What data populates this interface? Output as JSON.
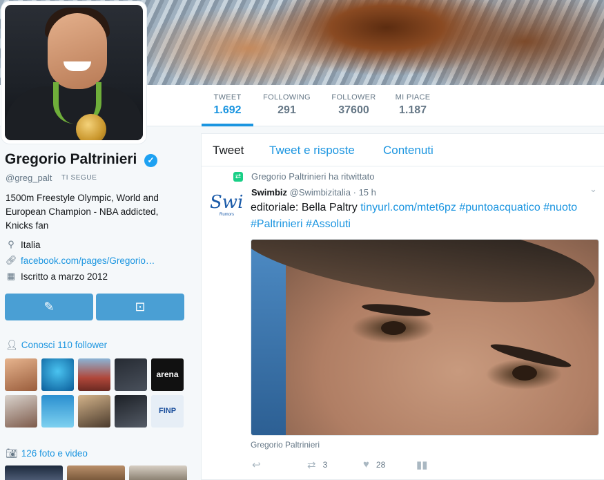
{
  "profile": {
    "name": "Gregorio Paltrinieri",
    "verified_icon": "verified-badge-icon",
    "handle": "@greg_palt",
    "follows_you": "TI SEGUE",
    "bio": "1500m Freestyle Olympic, World and European Champion - NBA addicted, Knicks fan",
    "location": "Italia",
    "website": "facebook.com/pages/Gregorio…",
    "joined": "Iscritto a marzo 2012"
  },
  "stats": [
    {
      "label": "TWEET",
      "value": "1.692"
    },
    {
      "label": "FOLLOWING",
      "value": "291"
    },
    {
      "label": "FOLLOWER",
      "value": "37600"
    },
    {
      "label": "MI PIACE",
      "value": "1.187"
    }
  ],
  "sidebar": {
    "followers_you_know": "Conosci 110 follower",
    "photos_videos": "126 foto e video",
    "follower_thumb_texts": {
      "arena": "arena",
      "finp": "FINP"
    }
  },
  "timeline": {
    "tabs": [
      "Tweet",
      "Tweet e risposte",
      "Contenuti"
    ],
    "retweet_note": "Gregorio Paltrinieri ha ritwittato",
    "tweet": {
      "author_name": "Swimbiz",
      "author_handle": "@Swimbizitalia",
      "time": "15 h",
      "text_plain": "editoriale: Bella Paltry ",
      "link": "tinyurl.com/mtet6pz",
      "hashtag1": "#puntoacquatico",
      "hashtag2": "#nuoto",
      "hashtag3": "#Paltrinieri",
      "hashtag4": "#Assoluti",
      "photo_caption": "Gregorio Paltrinieri",
      "avatar_text": "Swi",
      "avatar_subtext": "Rumors",
      "retweets": "3",
      "likes": "28"
    }
  },
  "colors": {
    "accent": "#1b95e0",
    "button": "#4a9fd4",
    "retweet_green": "#19cf86"
  }
}
